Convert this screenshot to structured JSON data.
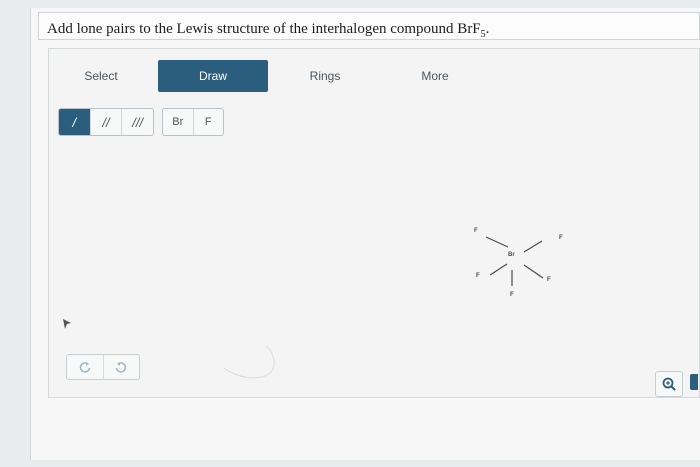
{
  "question": {
    "text_before": "Add lone pairs to the Lewis structure of the interhalogen compound BrF",
    "subscript": "5",
    "text_after": "."
  },
  "tabs": [
    {
      "label": "Select",
      "active": false
    },
    {
      "label": "Draw",
      "active": true
    },
    {
      "label": "Rings",
      "active": false
    },
    {
      "label": "More",
      "active": false
    }
  ],
  "bond_tools": [
    {
      "label": "/",
      "name": "single-bond",
      "active": true
    },
    {
      "label": "//",
      "name": "double-bond",
      "active": false
    },
    {
      "label": "///",
      "name": "triple-bond",
      "active": false
    }
  ],
  "atom_tools": [
    "Br",
    "F"
  ],
  "molecule": {
    "center": "Br",
    "ligands": [
      "F",
      "F",
      "F",
      "F",
      "F"
    ]
  },
  "controls": {
    "undo_icon": "undo-icon",
    "redo_icon": "redo-icon",
    "zoom_icon": "zoom-icon"
  },
  "colors": {
    "accent": "#2b5d7e",
    "icon_muted": "#a3bccd"
  }
}
